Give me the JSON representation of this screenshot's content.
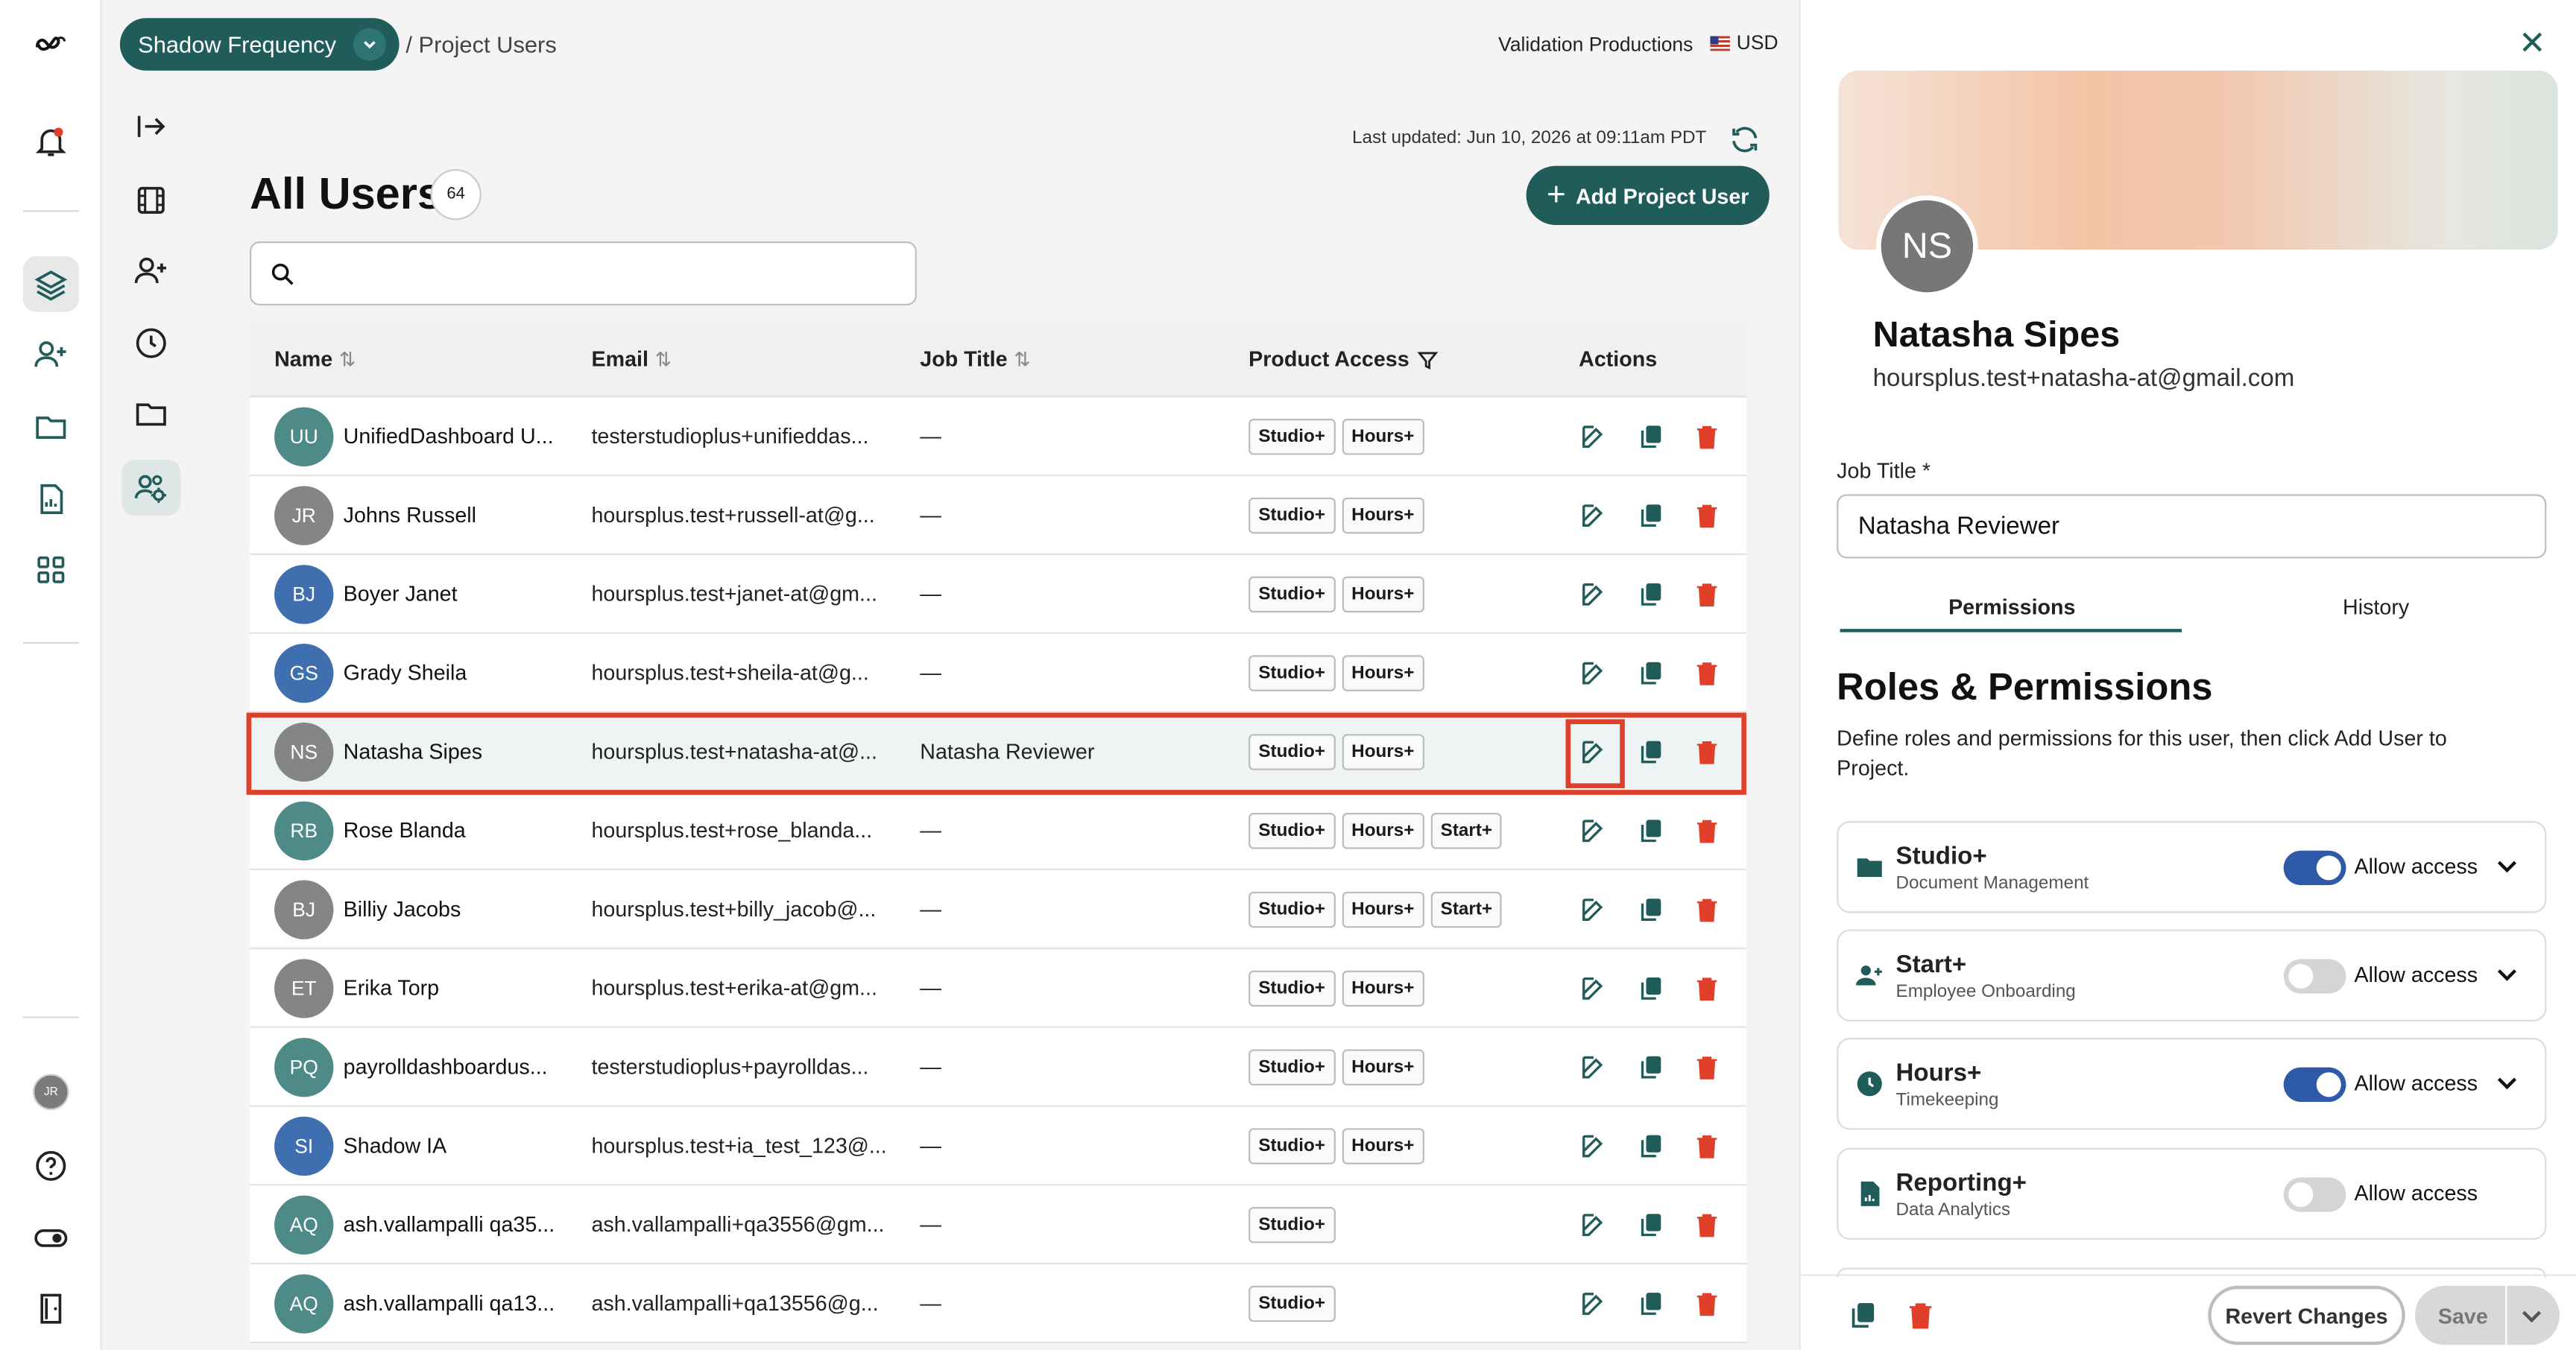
{
  "header": {
    "project_name": "Shadow Frequency",
    "breadcrumb": "/ Project Users",
    "company": "Validation Productions",
    "currency": "USD",
    "last_updated": "Last updated: Jun 10, 2026 at 09:11am PDT"
  },
  "page": {
    "title": "All Users",
    "count": "64",
    "add_button": "Add Project User",
    "search_placeholder": ""
  },
  "table": {
    "columns": [
      "Name",
      "Email",
      "Job Title",
      "Product Access",
      "Actions"
    ],
    "rows": [
      {
        "initials": "UU",
        "color": "#4e8a87",
        "name": "UnifiedDashboard U...",
        "email": "testerstudioplus+unifieddas...",
        "job": "—",
        "access": [
          "Studio+",
          "Hours+"
        ]
      },
      {
        "initials": "JR",
        "color": "#858585",
        "name": "Johns Russell",
        "email": "hoursplus.test+russell-at@g...",
        "job": "—",
        "access": [
          "Studio+",
          "Hours+"
        ]
      },
      {
        "initials": "BJ",
        "color": "#3f6fae",
        "name": "Boyer Janet",
        "email": "hoursplus.test+janet-at@gm...",
        "job": "—",
        "access": [
          "Studio+",
          "Hours+"
        ]
      },
      {
        "initials": "GS",
        "color": "#3f6fae",
        "name": "Grady Sheila",
        "email": "hoursplus.test+sheila-at@g...",
        "job": "—",
        "access": [
          "Studio+",
          "Hours+"
        ]
      },
      {
        "initials": "NS",
        "color": "#858585",
        "name": "Natasha Sipes",
        "email": "hoursplus.test+natasha-at@...",
        "job": "Natasha Reviewer",
        "access": [
          "Studio+",
          "Hours+"
        ],
        "selected": true
      },
      {
        "initials": "RB",
        "color": "#4e8a87",
        "name": "Rose Blanda",
        "email": "hoursplus.test+rose_blanda...",
        "job": "—",
        "access": [
          "Studio+",
          "Hours+",
          "Start+"
        ]
      },
      {
        "initials": "BJ",
        "color": "#858585",
        "name": "Billiy Jacobs",
        "email": "hoursplus.test+billy_jacob@...",
        "job": "—",
        "access": [
          "Studio+",
          "Hours+",
          "Start+"
        ]
      },
      {
        "initials": "ET",
        "color": "#858585",
        "name": "Erika Torp",
        "email": "hoursplus.test+erika-at@gm...",
        "job": "—",
        "access": [
          "Studio+",
          "Hours+"
        ]
      },
      {
        "initials": "PQ",
        "color": "#4e8a87",
        "name": "payrolldashboardus...",
        "email": "testerstudioplus+payrolldas...",
        "job": "—",
        "access": [
          "Studio+",
          "Hours+"
        ]
      },
      {
        "initials": "SI",
        "color": "#3f6fae",
        "name": "Shadow IA",
        "email": "hoursplus.test+ia_test_123@...",
        "job": "—",
        "access": [
          "Studio+",
          "Hours+"
        ]
      },
      {
        "initials": "AQ",
        "color": "#4e8a87",
        "name": "ash.vallampalli qa35...",
        "email": "ash.vallampalli+qa3556@gm...",
        "job": "—",
        "access": [
          "Studio+"
        ]
      },
      {
        "initials": "AQ",
        "color": "#4e8a87",
        "name": "ash.vallampalli qa13...",
        "email": "ash.vallampalli+qa13556@g...",
        "job": "—",
        "access": [
          "Studio+"
        ]
      }
    ]
  },
  "sidebar": {
    "user_initials": "JR"
  },
  "panel": {
    "initials": "NS",
    "name": "Natasha Sipes",
    "email": "hoursplus.test+natasha-at@gmail.com",
    "job_title_label": "Job Title *",
    "job_title_value": "Natasha Reviewer",
    "tabs": [
      "Permissions",
      "History"
    ],
    "roles_title": "Roles & Permissions",
    "roles_desc": "Define roles and permissions for this user, then click Add User to Project.",
    "permissions": [
      {
        "title": "Studio+",
        "subtitle": "Document Management",
        "enabled": true,
        "label": "Allow access",
        "expand": true,
        "icon": "folder-icon"
      },
      {
        "title": "Start+",
        "subtitle": "Employee Onboarding",
        "enabled": false,
        "label": "Allow access",
        "expand": true,
        "icon": "user-add-icon"
      },
      {
        "title": "Hours+",
        "subtitle": "Timekeeping",
        "enabled": true,
        "label": "Allow access",
        "expand": true,
        "icon": "clock-icon"
      },
      {
        "title": "Reporting+",
        "subtitle": "Data Analytics",
        "enabled": false,
        "label": "Allow access",
        "expand": false,
        "icon": "report-icon"
      }
    ],
    "revert_label": "Revert Changes",
    "save_label": "Save"
  },
  "colors": {
    "brand": "#1f5c5a",
    "toggle_on": "#2f5aa8",
    "delete": "#e0402a",
    "highlight": "#e0402a"
  }
}
